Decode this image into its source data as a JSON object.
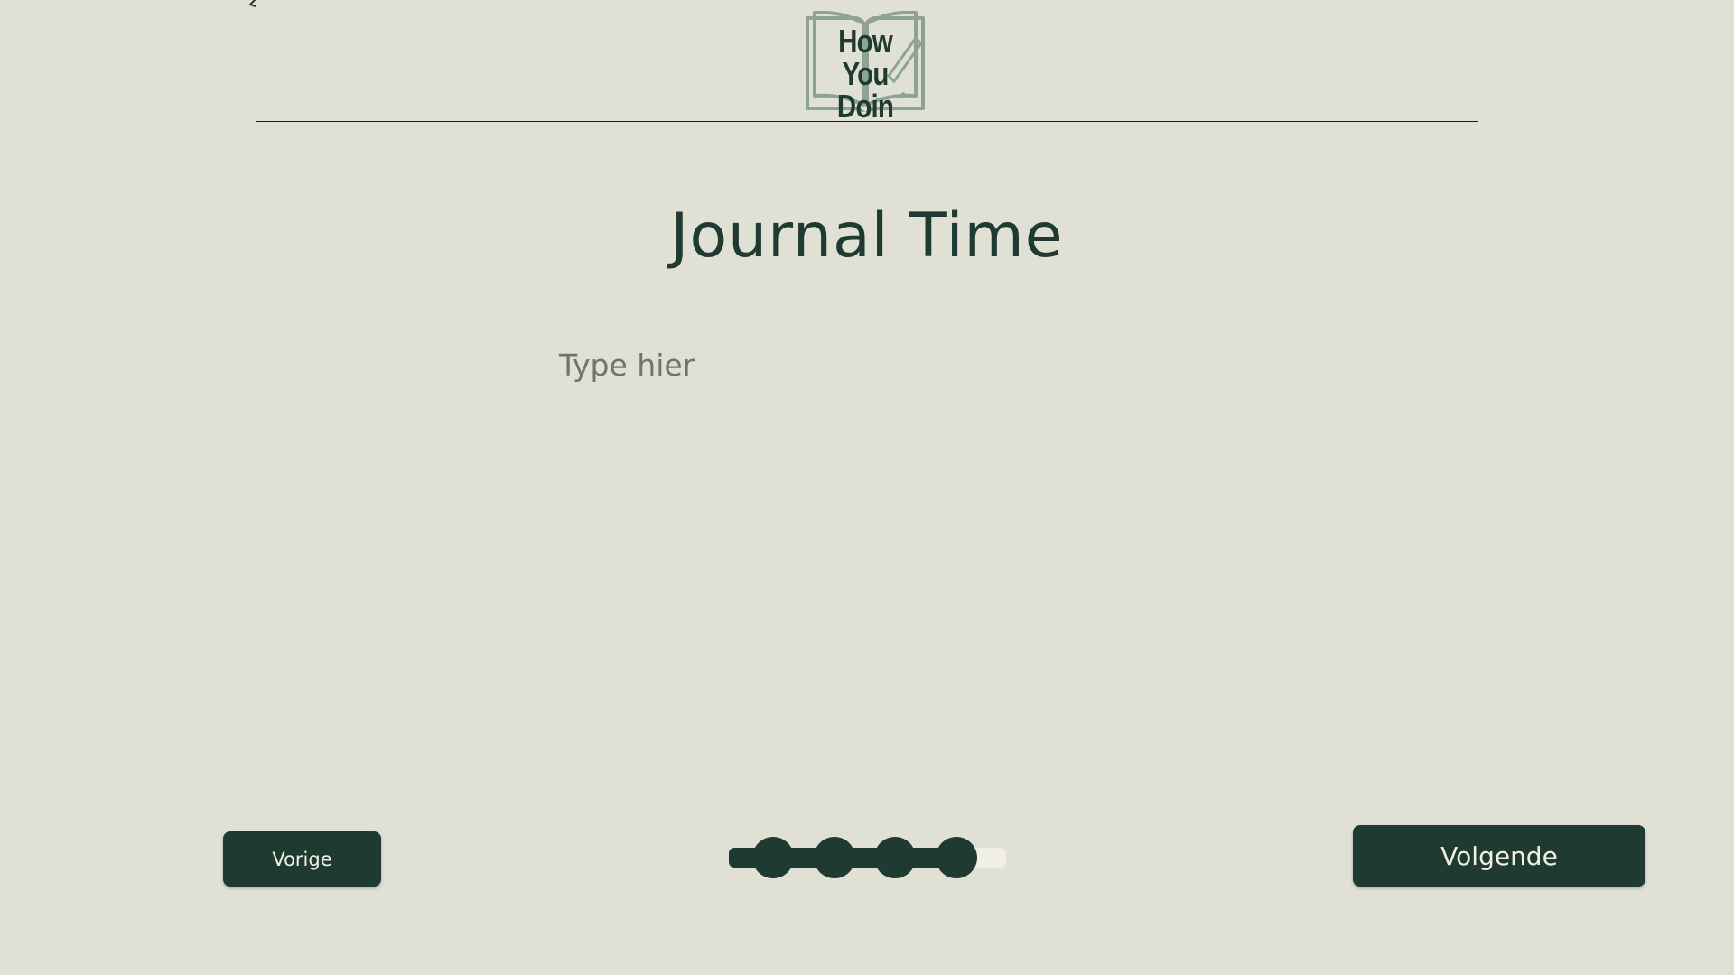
{
  "header": {
    "logo": {
      "text_line1": "How  You",
      "text_line2": "Doin"
    }
  },
  "main": {
    "title": "Journal Time",
    "journal_input": {
      "placeholder": "Type hier",
      "value": ""
    }
  },
  "footer": {
    "prev_label": "Vorige",
    "next_label": "Volgende",
    "progress": {
      "completed_steps": 4,
      "fill_fraction": 0.88
    }
  },
  "colors": {
    "background": "#e1e0d5",
    "primary": "#1f3a30",
    "button_text": "#f1efe4",
    "logo_outline": "#8fa395"
  }
}
